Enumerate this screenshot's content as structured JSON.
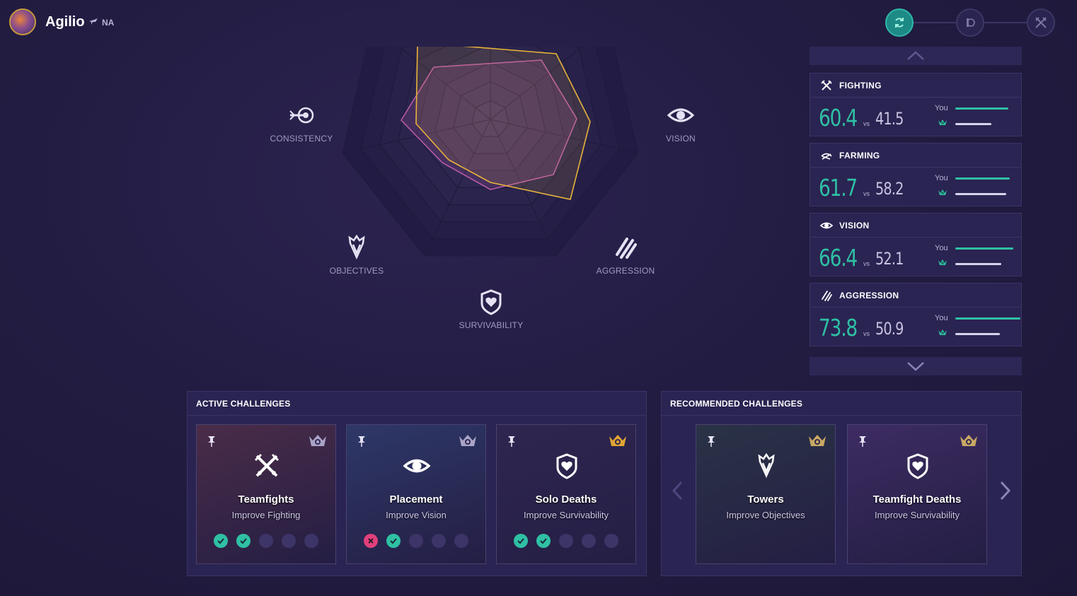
{
  "header": {
    "username": "Agilio",
    "region": "NA",
    "steps": [
      "refresh-icon",
      "lol-icon",
      "swords-icon"
    ]
  },
  "radar": {
    "axes": [
      {
        "label": "CONSISTENCY",
        "icon": "target-arrow-icon"
      },
      {
        "label": "VISION",
        "icon": "eye-icon"
      },
      {
        "label": "AGGRESSION",
        "icon": "claw-icon"
      },
      {
        "label": "SURVIVABILITY",
        "icon": "shield-heart-icon"
      },
      {
        "label": "OBJECTIVES",
        "icon": "objective-icon"
      }
    ],
    "colors": {
      "you": "#e8b33a",
      "average": "#b65aa6"
    }
  },
  "stats": [
    {
      "title": "FIGHTING",
      "icon": "crossed-swords-icon",
      "you": "60.4",
      "vs": "vs",
      "avg": "41.5",
      "you_label": "You",
      "you_level": 0.604,
      "avg_level": 0.415
    },
    {
      "title": "FARMING",
      "icon": "farming-icon",
      "you": "61.7",
      "vs": "vs",
      "avg": "58.2",
      "you_label": "You",
      "you_level": 0.617,
      "avg_level": 0.582
    },
    {
      "title": "VISION",
      "icon": "eye-icon",
      "you": "66.4",
      "vs": "vs",
      "avg": "52.1",
      "you_label": "You",
      "you_level": 0.664,
      "avg_level": 0.521
    },
    {
      "title": "AGGRESSION",
      "icon": "claw-icon",
      "you": "73.8",
      "vs": "vs",
      "avg": "50.9",
      "you_label": "You",
      "you_level": 0.738,
      "avg_level": 0.509
    }
  ],
  "active": {
    "title": "ACTIVE CHALLENGES",
    "cards": [
      {
        "title": "Teamfights",
        "subtitle": "Improve Fighting",
        "icon": "crossed-swords-icon",
        "rank_color": "#a9a3c6",
        "bg": "#4a2c48",
        "progress": [
          "ok",
          "ok",
          "empty",
          "empty",
          "empty"
        ]
      },
      {
        "title": "Placement",
        "subtitle": "Improve Vision",
        "icon": "eye-icon",
        "rank_color": "#a9a3c6",
        "bg": "#2e3868",
        "progress": [
          "fail",
          "ok",
          "empty",
          "empty",
          "empty"
        ]
      },
      {
        "title": "Solo Deaths",
        "subtitle": "Improve Survivability",
        "icon": "shield-heart-icon",
        "rank_color": "#e0a433",
        "bg": "#2f2650",
        "progress": [
          "ok",
          "ok",
          "empty",
          "empty",
          "empty"
        ]
      }
    ]
  },
  "recommended": {
    "title": "RECOMMENDED CHALLENGES",
    "cards": [
      {
        "title": "Towers",
        "subtitle": "Improve Objectives",
        "icon": "objective-icon",
        "rank_color": "#c9a863",
        "bg": "#2a3346"
      },
      {
        "title": "Teamfight Deaths",
        "subtitle": "Improve Survivability",
        "icon": "shield-heart-icon",
        "rank_color": "#c9a863",
        "bg": "#3d2c62"
      }
    ]
  }
}
